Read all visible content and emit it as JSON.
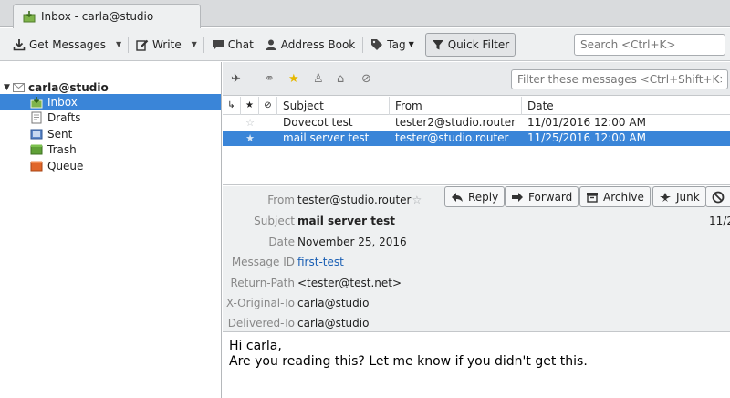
{
  "tab": {
    "title": "Inbox - carla@studio",
    "icon": "inbox-icon"
  },
  "toolbar": {
    "get_messages": "Get Messages",
    "write": "Write",
    "chat": "Chat",
    "address_book": "Address Book",
    "tag": "Tag",
    "quick_filter": "Quick Filter",
    "search_placeholder": "Search <Ctrl+K>"
  },
  "folders": {
    "account": "carla@studio",
    "items": [
      {
        "label": "Inbox",
        "selected": true
      },
      {
        "label": "Drafts"
      },
      {
        "label": "Sent"
      },
      {
        "label": "Trash"
      },
      {
        "label": "Queue"
      }
    ]
  },
  "quick_filter_bar": {
    "filter_placeholder": "Filter these messages <Ctrl+Shift+K>"
  },
  "message_list": {
    "columns": {
      "subject": "Subject",
      "from": "From",
      "date": "Date"
    },
    "rows": [
      {
        "subject": "Dovecot test",
        "from": "tester2@studio.router",
        "date": "11/01/2016 12:00 AM",
        "selected": false
      },
      {
        "subject": "mail server test",
        "from": "tester@studio.router",
        "date": "11/25/2016 12:00 AM",
        "selected": true
      }
    ]
  },
  "header_pane": {
    "labels": {
      "from": "From",
      "subject": "Subject",
      "date": "Date",
      "message_id": "Message ID",
      "return_path": "Return-Path",
      "x_original_to": "X-Original-To",
      "delivered_to": "Delivered-To"
    },
    "values": {
      "from": "tester@studio.router",
      "subject": "mail server test",
      "date": "November 25, 2016",
      "message_id": "first-test",
      "return_path": "<tester@test.net>",
      "x_original_to": "carla@studio",
      "delivered_to": "carla@studio",
      "date_clipped": "11/2"
    },
    "actions": {
      "reply": "Reply",
      "forward": "Forward",
      "archive": "Archive",
      "junk": "Junk"
    }
  },
  "body": {
    "line1": "Hi carla,",
    "line2": "Are you reading this? Let me know if you didn't get this."
  },
  "colors": {
    "selection": "#3a85d8",
    "link": "#1a5fb4"
  }
}
